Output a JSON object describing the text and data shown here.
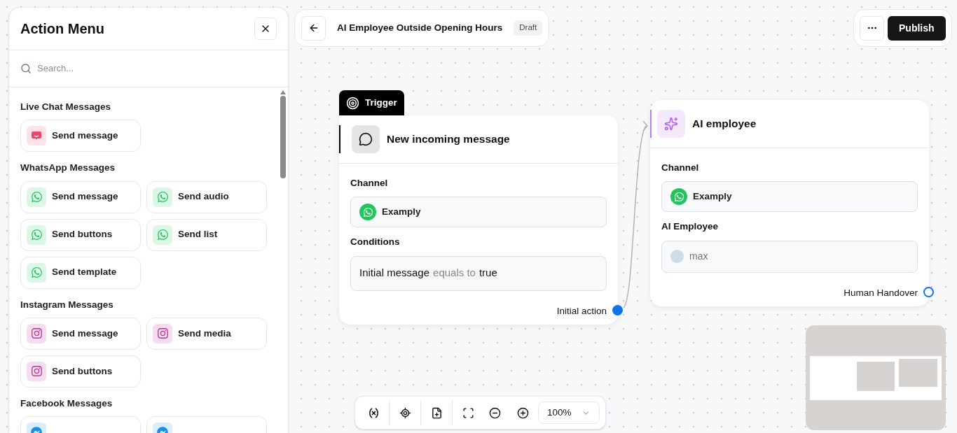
{
  "action_menu": {
    "title": "Action Menu",
    "search": {
      "placeholder": "Search..."
    },
    "sections": [
      {
        "title": "Live Chat Messages",
        "items": [
          {
            "kind": "livechat",
            "label": "Send message"
          }
        ]
      },
      {
        "title": "WhatsApp Messages",
        "items": [
          {
            "kind": "whatsapp",
            "label": "Send message"
          },
          {
            "kind": "whatsapp",
            "label": "Send audio"
          },
          {
            "kind": "whatsapp",
            "label": "Send buttons"
          },
          {
            "kind": "whatsapp",
            "label": "Send list"
          },
          {
            "kind": "whatsapp",
            "label": "Send template"
          }
        ]
      },
      {
        "title": "Instagram Messages",
        "items": [
          {
            "kind": "instagram",
            "label": "Send message"
          },
          {
            "kind": "instagram",
            "label": "Send media"
          },
          {
            "kind": "instagram",
            "label": "Send buttons"
          }
        ]
      },
      {
        "title": "Facebook Messages",
        "items": [
          {
            "kind": "facebook"
          },
          {
            "kind": "facebook"
          }
        ]
      }
    ]
  },
  "header": {
    "title": "AI Employee Outside Opening Hours",
    "status": "Draft",
    "publish": "Publish"
  },
  "trigger_node": {
    "tag": "Trigger",
    "title": "New incoming message",
    "channel_label": "Channel",
    "channel": "Examply",
    "conditions_label": "Conditions",
    "condition": {
      "field": "Initial message",
      "operator": "equals to",
      "value": "true"
    },
    "output": "Initial action"
  },
  "ai_node": {
    "title": "AI employee",
    "channel_label": "Channel",
    "channel": "Examply",
    "employee_label": "AI Employee",
    "employee": "max",
    "output": "Human Handover"
  },
  "toolbar": {
    "zoom": "100%"
  }
}
